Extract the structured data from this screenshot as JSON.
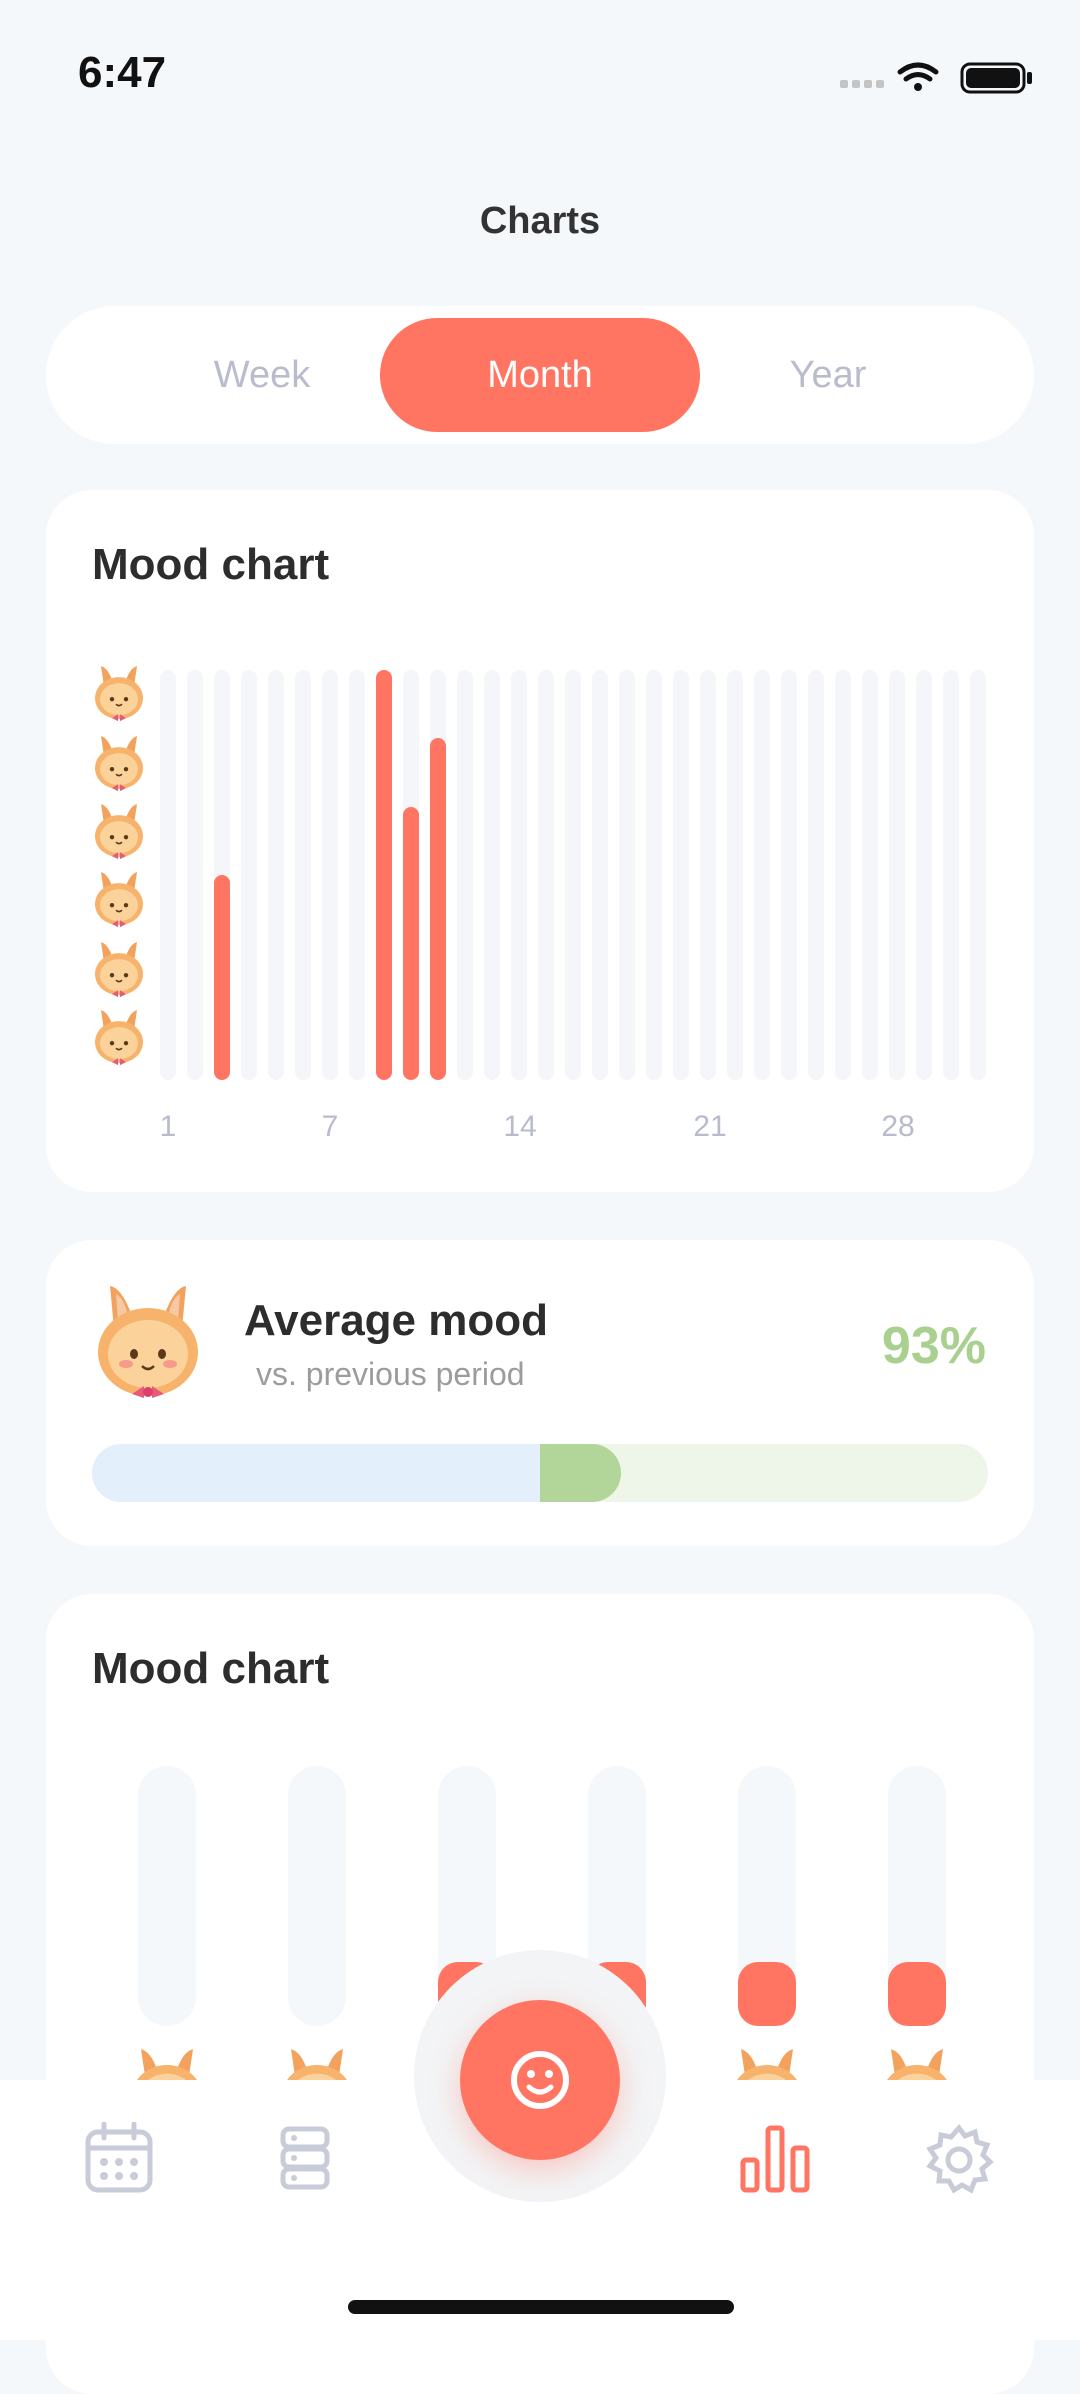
{
  "status": {
    "time": "6:47"
  },
  "header": {
    "title": "Charts"
  },
  "period_tabs": {
    "items": [
      "Week",
      "Month",
      "Year"
    ],
    "selected": "Month"
  },
  "mood_chart_month": {
    "title": "Mood chart",
    "x_tick_labels": [
      "1",
      "7",
      "14",
      "21",
      "28"
    ],
    "chart_data": {
      "type": "bar",
      "x": [
        1,
        2,
        3,
        4,
        5,
        6,
        7,
        8,
        9,
        10,
        11,
        12,
        13,
        14,
        15,
        16,
        17,
        18,
        19,
        20,
        21,
        22,
        23,
        24,
        25,
        26,
        27,
        28,
        29,
        30,
        31
      ],
      "values": [
        null,
        null,
        3,
        null,
        null,
        null,
        null,
        null,
        6,
        4,
        5,
        null,
        null,
        null,
        null,
        null,
        null,
        null,
        null,
        null,
        null,
        null,
        null,
        null,
        null,
        null,
        null,
        null,
        null,
        null,
        null
      ],
      "y_scale_levels": 6,
      "ylim": [
        0,
        6
      ],
      "colors": {
        "bar": "#ff7562",
        "track": "#f4f6f9"
      }
    }
  },
  "average_mood": {
    "title": "Average mood",
    "subtitle": "vs. previous period",
    "percent_label": "93%",
    "bar": {
      "previous_fraction": 0.5,
      "current_fraction": 0.59
    },
    "colors": {
      "percent": "#a9d08e",
      "previous": "#e3effb",
      "current": "#b2d59a",
      "track": "#eef6e9"
    }
  },
  "mood_chart_distribution": {
    "title": "Mood chart",
    "chart_data": {
      "type": "bar",
      "categories": [
        "level-6",
        "level-5",
        "level-4",
        "level-3",
        "level-2",
        "level-1"
      ],
      "values": [
        0,
        0,
        1,
        1,
        1,
        1
      ]
    }
  },
  "tabbar": {
    "items": [
      "calendar-icon",
      "list-icon",
      "mood-add-icon",
      "stats-icon",
      "settings-icon"
    ],
    "active": "stats-icon",
    "colors": {
      "active": "#ff7562",
      "inactive": "#c8cbd8"
    }
  }
}
